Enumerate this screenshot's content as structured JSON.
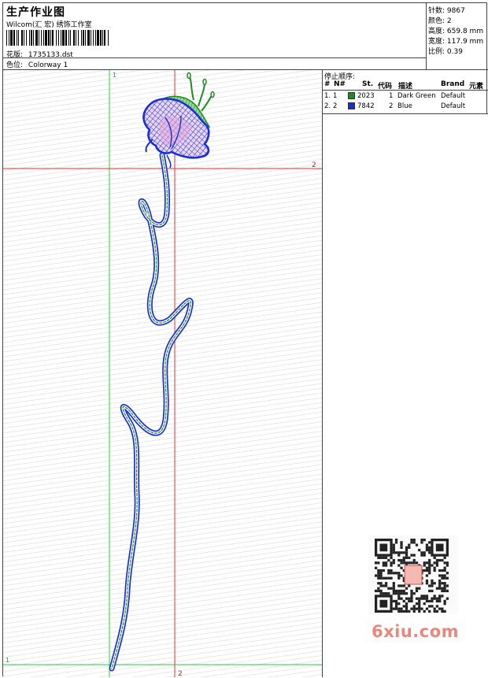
{
  "header": {
    "title": "生产作业图",
    "company": "Wilcom(汇 宏) 绣饰工作室",
    "design_label": "花版:",
    "design_file": "1735133.dst",
    "colorway_label": "色位:",
    "colorway": "Colorway 1"
  },
  "stats": {
    "stitches_label": "针数:",
    "stitches": "9867",
    "colors_label": "颜色:",
    "colors": "2",
    "height_label": "高度:",
    "height": "659.8 mm",
    "width_label": "宽度:",
    "width": "117.9 mm",
    "scale_label": "比例:",
    "scale": "0.39"
  },
  "stop_sequence": {
    "title": "停止顺序:",
    "columns": [
      "#",
      "N#",
      "St.",
      "代码",
      "描述",
      "Brand",
      "元素"
    ],
    "rows": [
      {
        "num": "1.",
        "n": "1",
        "color": "#1f8a1f",
        "stitches": "2023",
        "code": "1",
        "description": "Dark Green",
        "brand": "Default"
      },
      {
        "num": "2.",
        "n": "2",
        "color": "#1a2ee0",
        "stitches": "7842",
        "code": "2",
        "description": "Blue",
        "brand": "Default"
      }
    ]
  },
  "guides": {
    "green_label_top": "1",
    "green_label_bottom": "1",
    "red_label_right": "2",
    "red_label_bottom": "2"
  },
  "watermark": {
    "site": "6xiu.com"
  }
}
